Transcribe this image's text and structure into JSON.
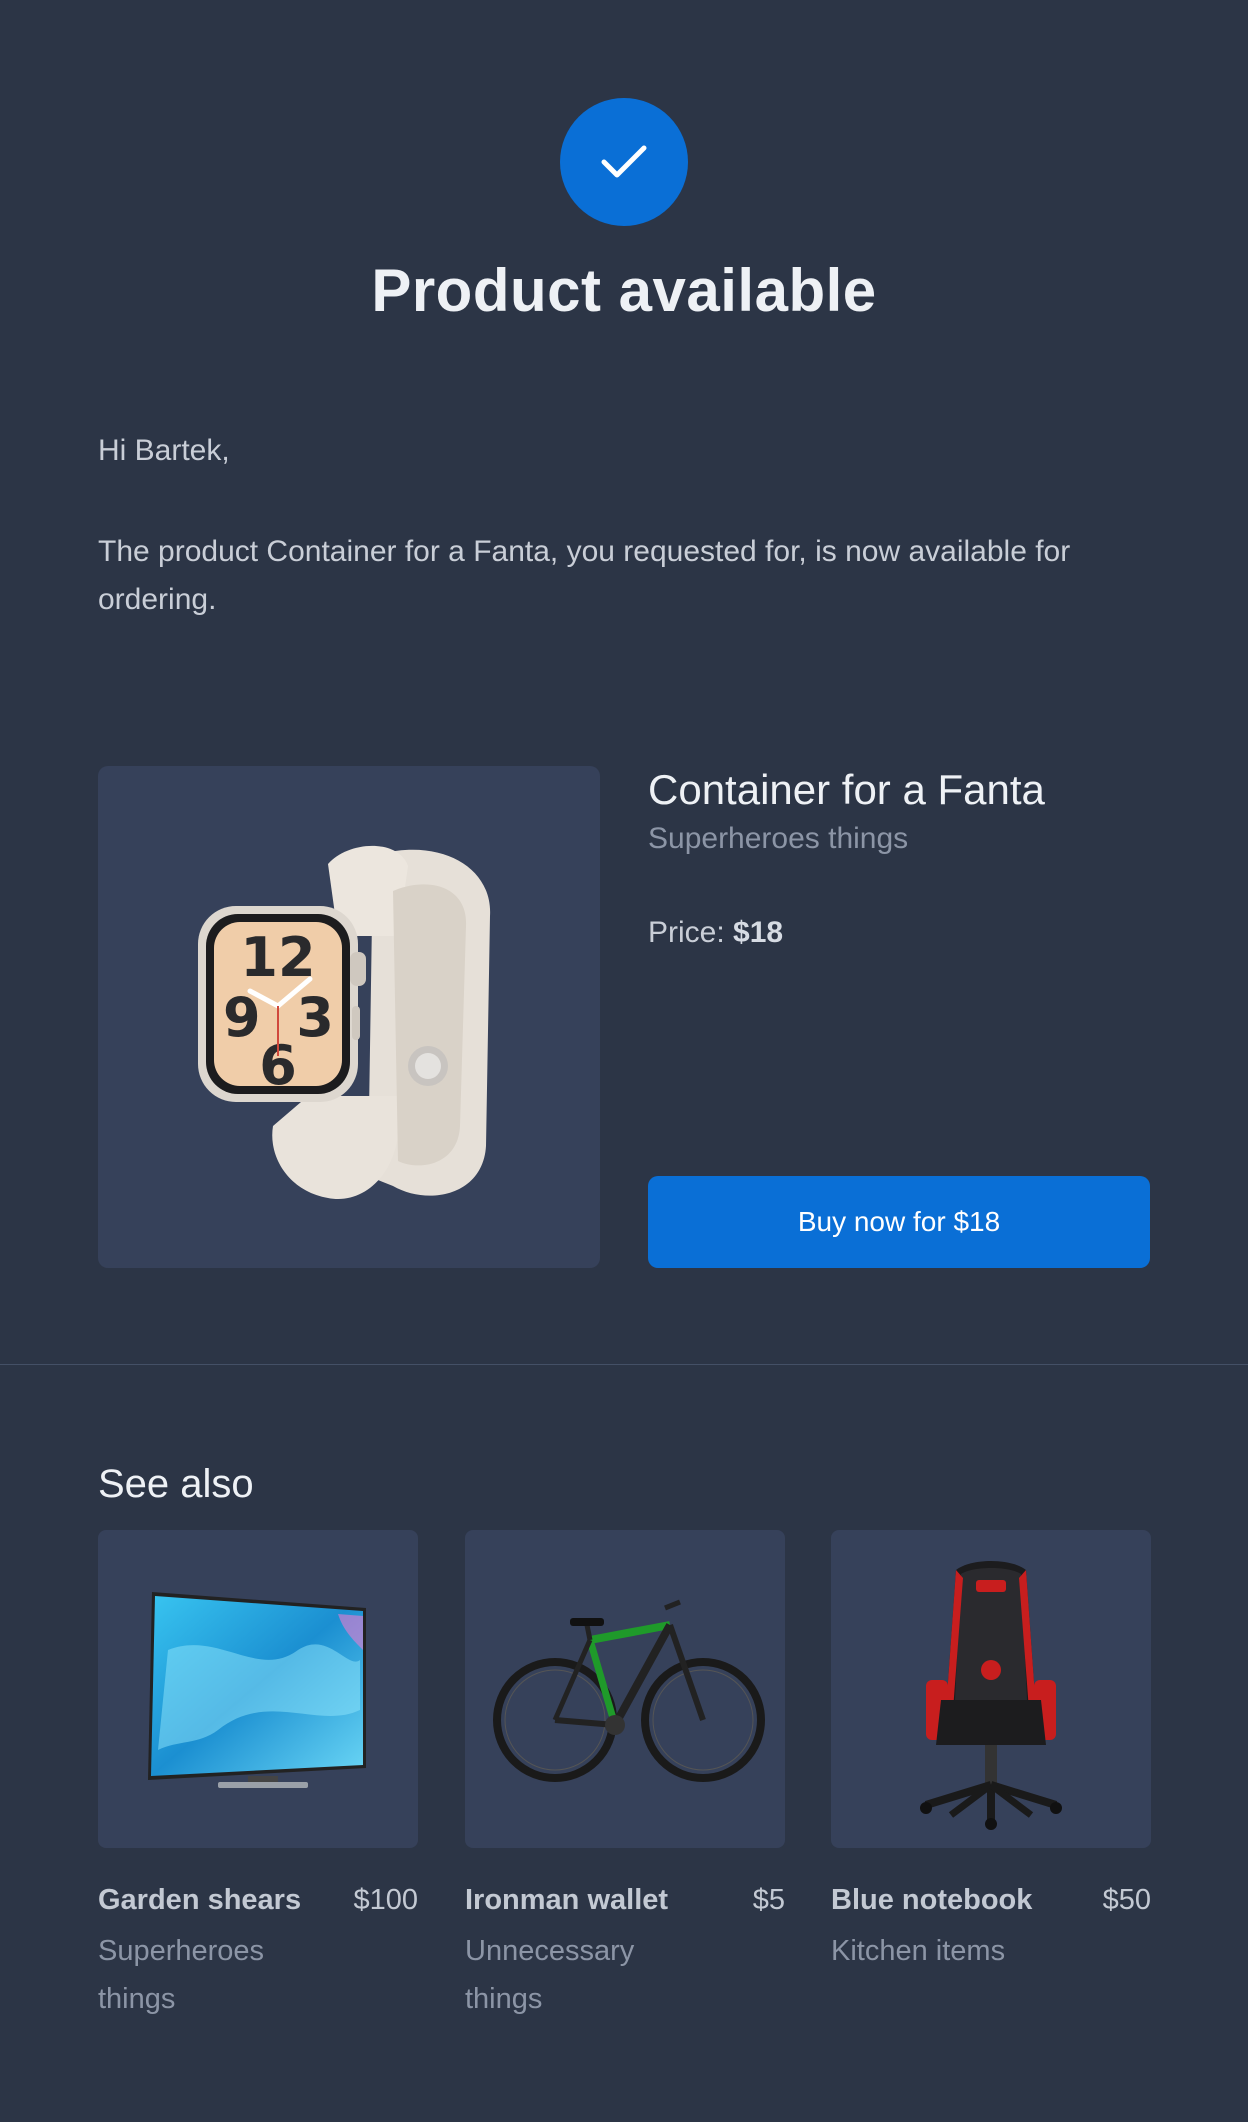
{
  "header": {
    "title": "Product available"
  },
  "message": {
    "greeting": "Hi Bartek,",
    "body": "The product Container for a Fanta, you requested for, is now available for ordering."
  },
  "product": {
    "name": "Container for a Fanta",
    "category": "Superheroes things",
    "price_label": "Price:",
    "price_value": "$18",
    "buy_button": "Buy now for $18",
    "image": "smartwatch-image"
  },
  "see_also": {
    "heading": "See also",
    "items": [
      {
        "name": "Garden shears",
        "price": "$100",
        "category": "Superheroes things",
        "image": "tv-image"
      },
      {
        "name": "Ironman wallet",
        "price": "$5",
        "category": "Unnecessary things",
        "image": "bicycle-image"
      },
      {
        "name": "Blue notebook",
        "price": "$50",
        "category": "Kitchen items",
        "image": "gaming-chair-image"
      }
    ]
  },
  "colors": {
    "background": "#2c3546",
    "card": "#36415a",
    "accent": "#0a6fd6",
    "muted_text": "#8c95a6"
  }
}
